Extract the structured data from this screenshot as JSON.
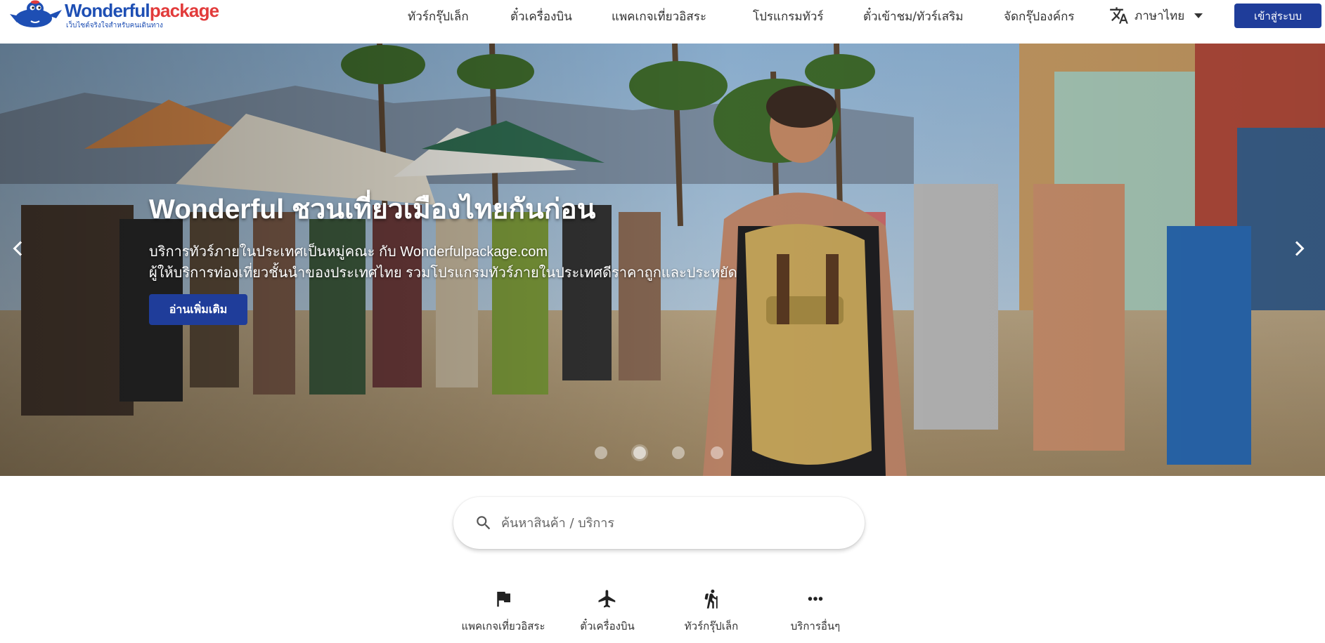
{
  "logo": {
    "name_part1": "Wonderful",
    "name_part2": "package",
    "tagline": "เว็บไซต์จริงใจสำหรับคนเดินทาง",
    "brand_blue": "#1e4fb4",
    "brand_red": "#e23b3b"
  },
  "nav": {
    "items": [
      {
        "label": "ทัวร์กรุ๊ปเล็ก"
      },
      {
        "label": "ตั๋วเครื่องบิน"
      },
      {
        "label": "แพคเกจเที่ยวอิสระ"
      },
      {
        "label": "โปรแกรมทัวร์"
      },
      {
        "label": "ตั๋วเข้าชม/ทัวร์เสริม"
      },
      {
        "label": "จัดกรุ๊ปองค์กร"
      }
    ],
    "language": {
      "icon": "translate-icon",
      "label": "ภาษาไทย"
    },
    "login_label": "เข้าสู่ระบบ",
    "accent": "#1f3d9a"
  },
  "hero": {
    "title": "Wonderful ชวนเที่ยวเมืองไทยกันก่อน",
    "line1": "บริการทัวร์ภายในประเทศเป็นหมู่คณะ กับ Wonderfulpackage.com",
    "line2": "ผู้ให้บริการท่องเที่ยวชั้นนำของประเทศไทย รวมโปรแกรมทัวร์ภายในประเทศดีราคาถูกและประหยัด",
    "button_label": "อ่านเพิ่มเติม",
    "slides_total": 4,
    "active_slide": 2
  },
  "search": {
    "placeholder": "ค้นหาสินค้า / บริการ",
    "value": ""
  },
  "categories": [
    {
      "label": "แพคเกจเที่ยวอิสระ",
      "icon": "flag-icon"
    },
    {
      "label": "ตั๋วเครื่องบิน",
      "icon": "airplane-icon"
    },
    {
      "label": "ทัวร์กรุ๊ปเล็ก",
      "icon": "hiker-icon"
    },
    {
      "label": "บริการอื่นๆ",
      "icon": "more-horizontal-icon"
    }
  ]
}
